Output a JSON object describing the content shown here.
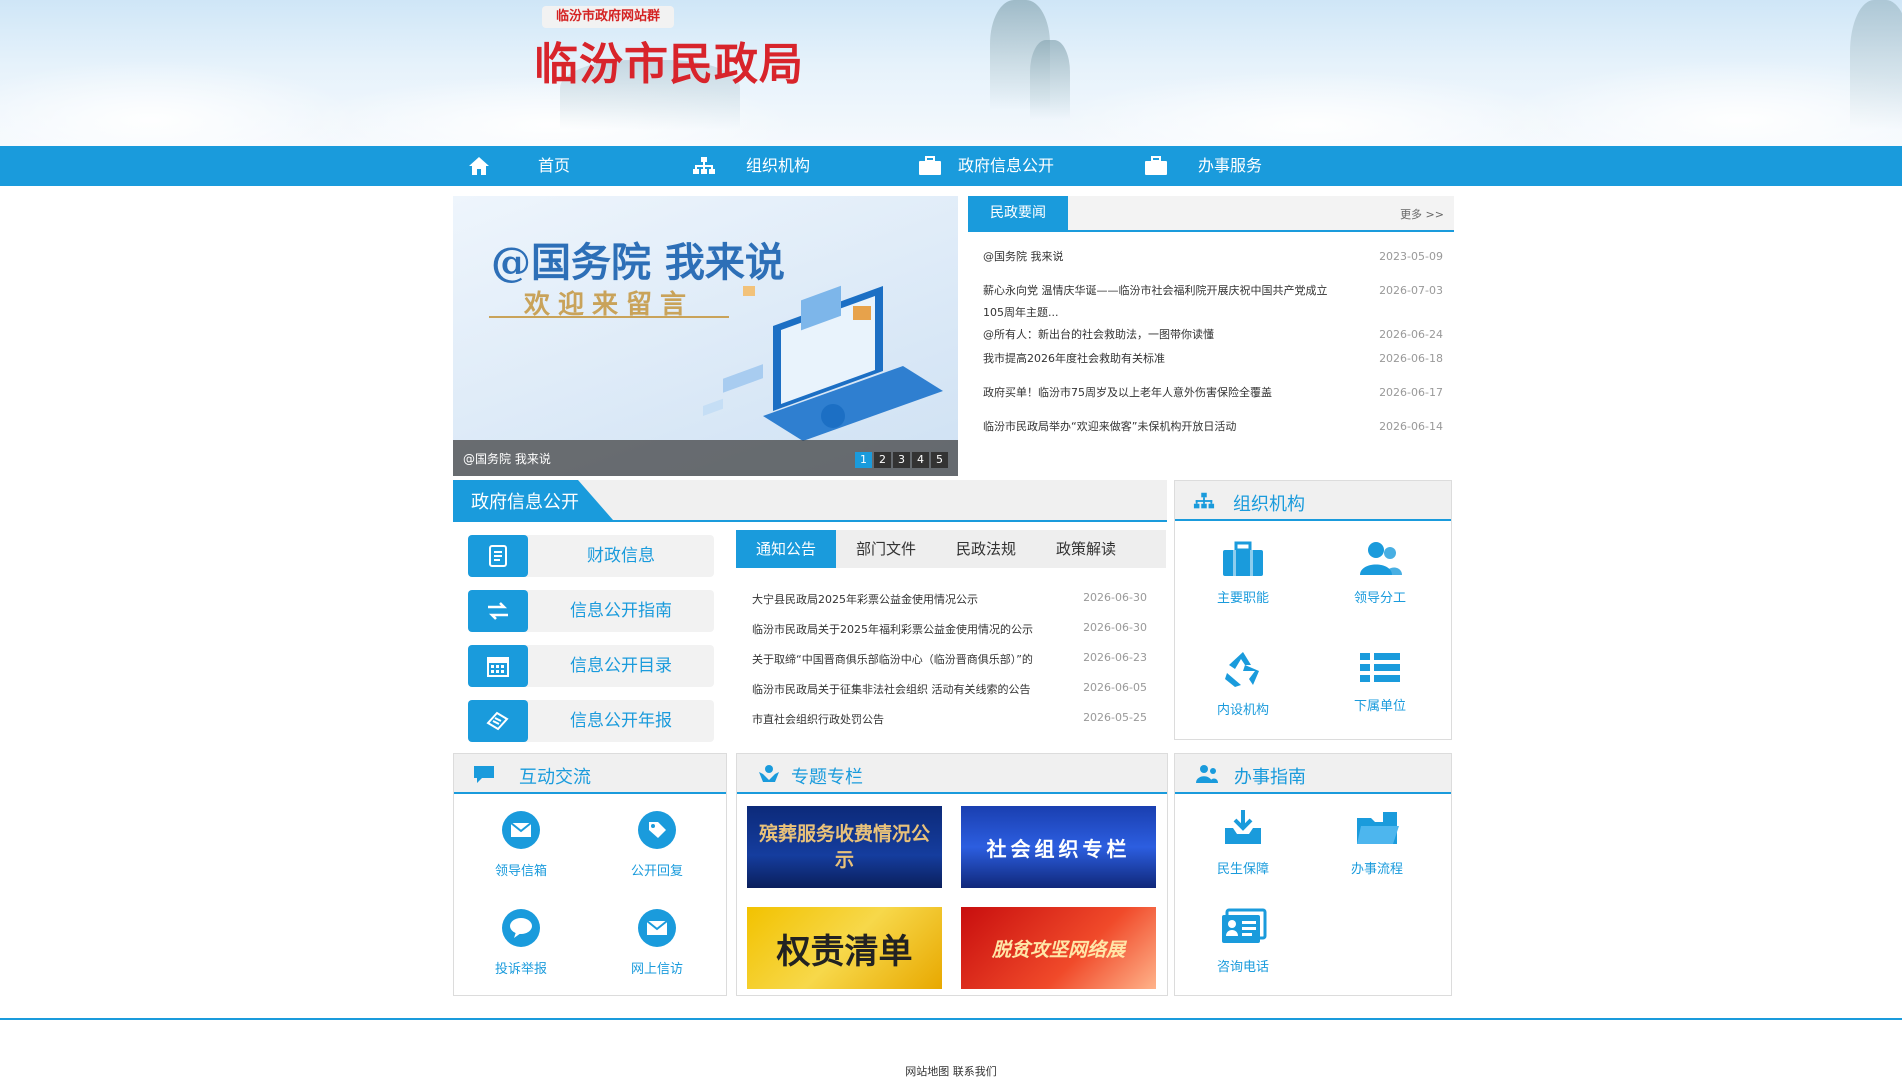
{
  "header": {
    "site_group": "临汾市政府网站群",
    "site_title": "临汾市民政局"
  },
  "nav": [
    {
      "label": "首页",
      "icon": "home-icon"
    },
    {
      "label": "组织机构",
      "icon": "org-chart-icon"
    },
    {
      "label": "政府信息公开",
      "icon": "briefcase-icon"
    },
    {
      "label": "办事服务",
      "icon": "briefcase-icon"
    }
  ],
  "slider": {
    "headline": "@国务院 我来说",
    "subline": "欢迎来留言",
    "caption": "@国务院 我来说",
    "pages": [
      "1",
      "2",
      "3",
      "4",
      "5"
    ],
    "active_page": "1"
  },
  "news": {
    "tab": "民政要闻",
    "more": "更多 >>",
    "items": [
      {
        "title": "@国务院 我来说",
        "date": "2023-05-09"
      },
      {
        "title": "薪心永向党 温情庆华诞——临汾市社会福利院开展庆祝中国共产党成立105周年主题...",
        "date": "2026-07-03"
      },
      {
        "title": "@所有人：新出台的社会救助法，一图带你读懂",
        "date": "2026-06-24"
      },
      {
        "title": "我市提高2026年度社会救助有关标准",
        "date": "2026-06-18"
      },
      {
        "title": "政府买单！临汾市75周岁及以上老年人意外伤害保险全覆盖",
        "date": "2026-06-17"
      },
      {
        "title": "临汾市民政局举办“欢迎来做客”未保机构开放日活动",
        "date": "2026-06-14"
      }
    ]
  },
  "gov_info": {
    "title": "政府信息公开",
    "buttons": [
      {
        "label": "财政信息",
        "icon": "document-icon"
      },
      {
        "label": "信息公开指南",
        "icon": "exchange-arrows-icon"
      },
      {
        "label": "信息公开目录",
        "icon": "calendar-icon"
      },
      {
        "label": "信息公开年报",
        "icon": "report-icon"
      }
    ],
    "tabs": [
      "通知公告",
      "部门文件",
      "民政法规",
      "政策解读"
    ],
    "active_tab": "通知公告",
    "items": [
      {
        "title": "大宁县民政局2025年彩票公益金使用情况公示",
        "date": "2026-06-30"
      },
      {
        "title": "临汾市民政局关于2025年福利彩票公益金使用情况的公示",
        "date": "2026-06-30"
      },
      {
        "title": "关于取缔“中国晋商俱乐部临汾中心（临汾晋商俱乐部）”的",
        "date": "2026-06-23"
      },
      {
        "title": "临汾市民政局关于征集非法社会组织 活动有关线索的公告",
        "date": "2026-06-05"
      },
      {
        "title": "市直社会组织行政处罚公告",
        "date": "2026-05-25"
      }
    ]
  },
  "org": {
    "title": "组织机构",
    "tiles": [
      {
        "label": "主要职能",
        "icon": "briefcase-icon"
      },
      {
        "label": "领导分工",
        "icon": "people-icon"
      },
      {
        "label": "内设机构",
        "icon": "recycle-icon"
      },
      {
        "label": "下属单位",
        "icon": "list-icon"
      }
    ]
  },
  "interaction": {
    "title": "互动交流",
    "tiles": [
      {
        "label": "领导信箱",
        "icon": "mail-icon"
      },
      {
        "label": "公开回复",
        "icon": "tag-icon"
      },
      {
        "label": "投诉举报",
        "icon": "chat-bubble-icon"
      },
      {
        "label": "网上信访",
        "icon": "mail-icon"
      }
    ]
  },
  "special": {
    "title": "专题专栏",
    "banners": [
      {
        "text": "殡葬服务收费情况公示"
      },
      {
        "text": "社会组织专栏"
      },
      {
        "text": "权责清单"
      },
      {
        "text": "脱贫攻坚网络展"
      }
    ]
  },
  "guide": {
    "title": "办事指南",
    "tiles": [
      {
        "label": "民生保障",
        "icon": "download-tray-icon"
      },
      {
        "label": "办事流程",
        "icon": "folder-icon"
      },
      {
        "label": "咨询电话",
        "icon": "contact-card-icon"
      }
    ]
  },
  "footer": {
    "text": "网站地图 联系我们"
  },
  "colors": {
    "primary": "#1a9bdc",
    "title_red": "#d8242b",
    "nav_bg": "#1a9bdc"
  }
}
